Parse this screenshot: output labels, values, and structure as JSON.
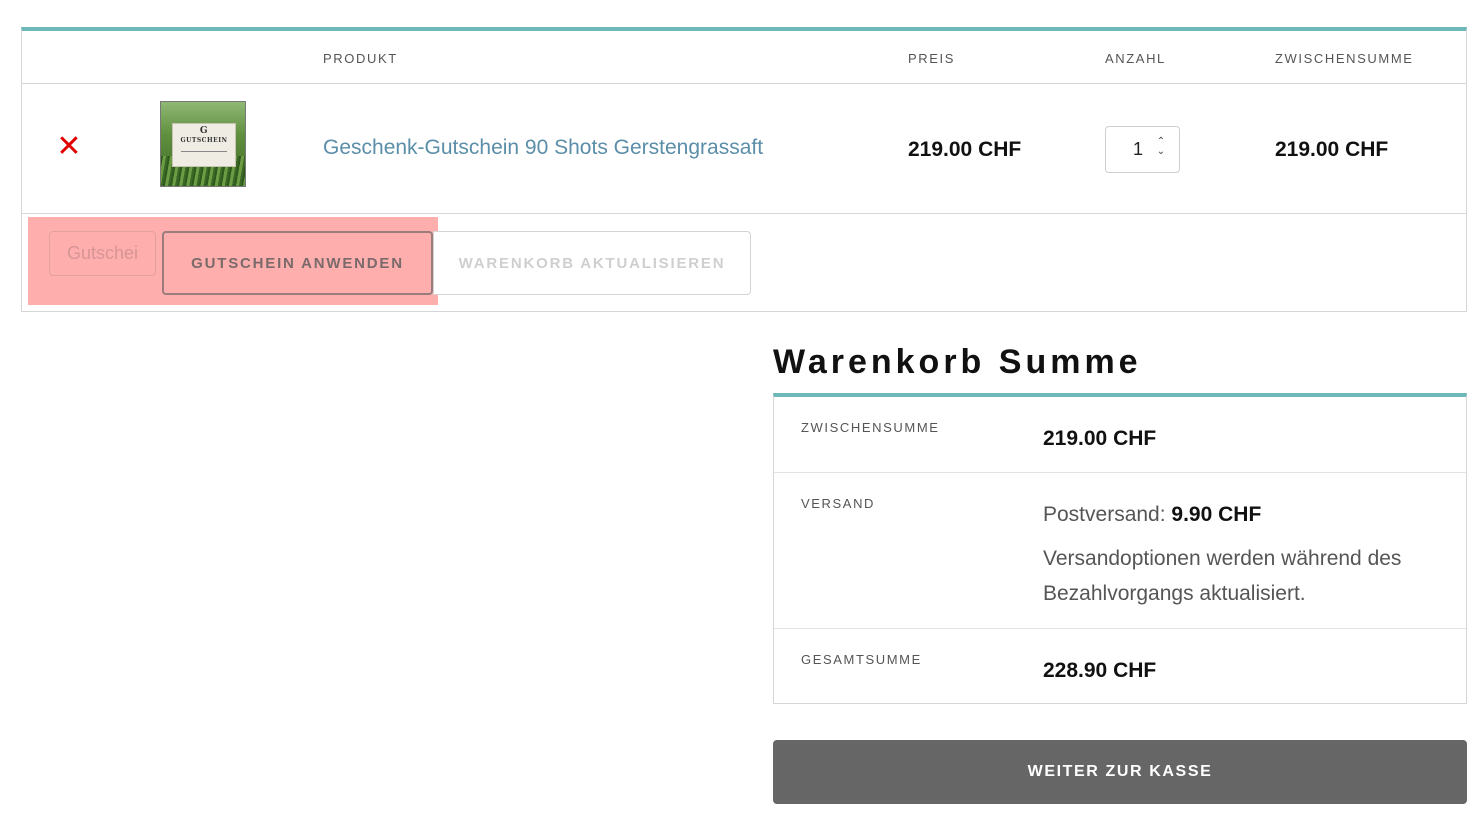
{
  "cart": {
    "headers": {
      "product": "PRODUKT",
      "price": "PREIS",
      "quantity": "ANZAHL",
      "subtotal": "ZWISCHENSUMME"
    },
    "items": [
      {
        "remove_icon": "close-x-icon",
        "remove_glyph": "✕",
        "thumbnail_text": "GUTSCHEIN",
        "thumbnail_monogram": "G",
        "name": "Geschenk-Gutschein 90 Shots Gerstengrassaft",
        "price": "219.00 CHF",
        "quantity": "1",
        "subtotal": "219.00 CHF"
      }
    ],
    "actions": {
      "coupon_placeholder": "Gutschei",
      "apply_label": "GUTSCHEIN ANWENDEN",
      "update_label": "WARENKORB AKTUALISIEREN"
    }
  },
  "totals": {
    "title": "Warenkorb Summe",
    "subtotal_label": "ZWISCHENSUMME",
    "subtotal_value": "219.00 CHF",
    "shipping_label": "VERSAND",
    "shipping_method": "Postversand: ",
    "shipping_price": "9.90 CHF",
    "shipping_note": "Versandoptionen werden während des Bezahlvorgangs aktualisiert.",
    "total_label": "GESAMTSUMME",
    "total_value": "228.90 CHF",
    "checkout_label": "WEITER ZUR KASSE"
  },
  "colors": {
    "accent_teal": "#6fb8b8",
    "link": "#5b8ea8",
    "remove_red": "#e00000",
    "checkout_bg": "#666666",
    "highlight": "#ff8c8c"
  }
}
